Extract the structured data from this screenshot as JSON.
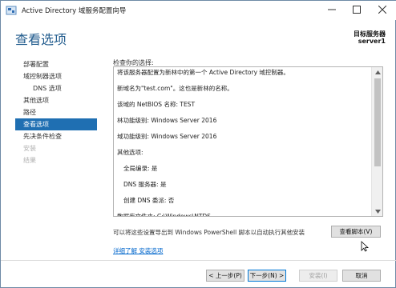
{
  "window": {
    "title": "Active Directory 域服务配置向导"
  },
  "header": {
    "page_title": "查看选项",
    "target_label": "目标服务器",
    "target_name": "server1"
  },
  "nav": {
    "items": [
      {
        "label": "部署配置",
        "state": "normal"
      },
      {
        "label": "域控制器选项",
        "state": "normal"
      },
      {
        "label": "DNS 选项",
        "state": "normal",
        "sub": true
      },
      {
        "label": "其他选项",
        "state": "normal"
      },
      {
        "label": "路径",
        "state": "normal"
      },
      {
        "label": "查看选项",
        "state": "active"
      },
      {
        "label": "先决条件检查",
        "state": "normal"
      },
      {
        "label": "安装",
        "state": "disabled"
      },
      {
        "label": "结果",
        "state": "disabled"
      }
    ]
  },
  "content": {
    "review_label": "检查你的选择:",
    "review_lines": [
      "将该服务器配置为新林中的第一个 Active Directory 域控制器。",
      "",
      "新域名为\"test.com\"。这也是新林的名称。",
      "",
      "该域的 NetBIOS 名称: TEST",
      "",
      "林功能级别: Windows Server 2016",
      "",
      "域功能级别: Windows Server 2016",
      "",
      "其他选项:",
      "",
      "  全局编录: 是",
      "",
      "  DNS 服务器: 是",
      "",
      "  创建 DNS 委派: 否",
      "",
      "数据库文件夹: C:\\Windows\\NTDS"
    ],
    "export_text": "可以将这些设置导出到 Windows PowerShell 脚本以自动执行其他安装",
    "view_script_label": "查看脚本(V)",
    "more_link": "详细了解 安装选项"
  },
  "footer": {
    "back_label": "< 上一步(P)",
    "next_label": "下一步(N) >",
    "install_label": "安装(I)",
    "cancel_label": "取消"
  },
  "colors": {
    "title_blue": "#1f5a8c",
    "nav_active": "#1f6fb2",
    "link": "#0066cc"
  }
}
